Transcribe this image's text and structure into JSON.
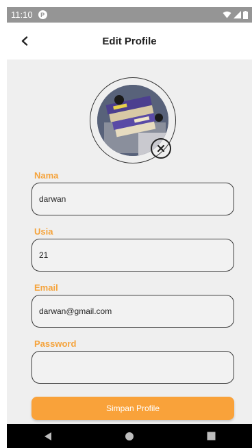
{
  "status_bar": {
    "time": "11:10",
    "notification_icon": "P"
  },
  "app_bar": {
    "title": "Edit Profile",
    "back_icon": "chevron-left-icon"
  },
  "profile_photo": {
    "remove_icon": "close-circle-icon"
  },
  "form": {
    "nama": {
      "label": "Nama",
      "value": "darwan"
    },
    "usia": {
      "label": "Usia",
      "value": "21"
    },
    "email": {
      "label": "Email",
      "value": "darwan@gmail.com"
    },
    "password": {
      "label": "Password",
      "value": ""
    },
    "save_label": "Simpan Profile"
  },
  "colors": {
    "accent": "#f9a23a",
    "label": "#f5a33b",
    "background": "#efefef"
  },
  "nav_icons": [
    "back-triangle-icon",
    "home-circle-icon",
    "recents-square-icon"
  ]
}
